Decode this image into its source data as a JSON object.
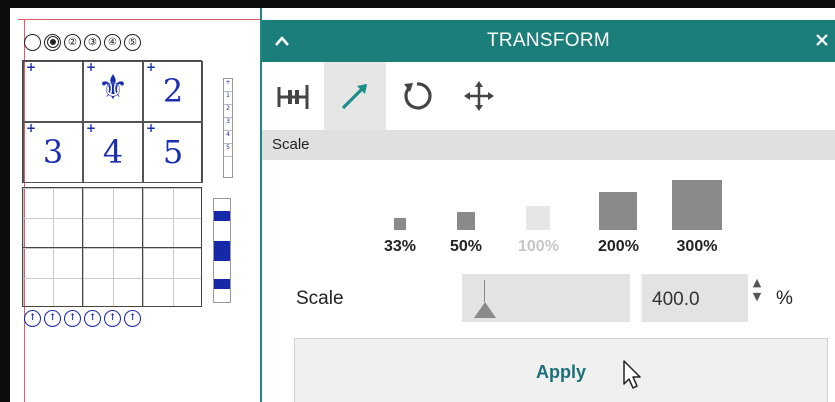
{
  "canvas": {
    "top_circles": [
      "",
      "",
      "②",
      "③",
      "④",
      "⑤"
    ],
    "bottom_circles": [
      "↑",
      "↑",
      "↑",
      "↑",
      "↑",
      "↑"
    ],
    "grid_cells": [
      {
        "plus": "+",
        "text": ""
      },
      {
        "plus": "+",
        "text": "⚜"
      },
      {
        "plus": "+",
        "text": "2"
      },
      {
        "plus": "+",
        "text": "3"
      },
      {
        "plus": "+",
        "text": "4"
      },
      {
        "plus": "+",
        "text": "5"
      }
    ]
  },
  "panel": {
    "title": "TRANSFORM",
    "collapse_icon": "chevron-up-icon",
    "close_icon": "close-icon",
    "tabs": [
      {
        "icon": "align-icon",
        "active": false
      },
      {
        "icon": "scale-arrow-icon",
        "active": true
      },
      {
        "icon": "rotate-icon",
        "active": false
      },
      {
        "icon": "move-icon",
        "active": false
      }
    ],
    "section_label": "Scale",
    "presets": [
      {
        "label": "33%",
        "enabled": true
      },
      {
        "label": "50%",
        "enabled": true
      },
      {
        "label": "100%",
        "enabled": false
      },
      {
        "label": "200%",
        "enabled": true
      },
      {
        "label": "300%",
        "enabled": true
      }
    ],
    "scale_label": "Scale",
    "scale_value": "400.0",
    "spin_up": "▲",
    "spin_down": "▼",
    "unit": "%",
    "apply_label": "Apply"
  },
  "colors": {
    "accent": "#1c7e7a",
    "apply_text": "#1c6f79",
    "preset_square": "#8a8a8a",
    "artwork_blue": "#1a2fb0"
  }
}
